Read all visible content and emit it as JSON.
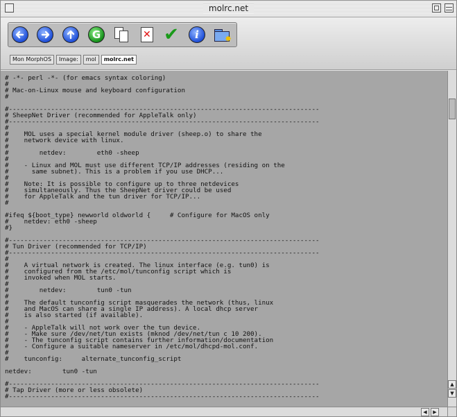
{
  "window": {
    "title": "molrc.net"
  },
  "toolbar": {
    "buttons": [
      {
        "name": "back-button",
        "icon": "arrow-left-icon"
      },
      {
        "name": "forward-button",
        "icon": "arrow-right-icon"
      },
      {
        "name": "up-button",
        "icon": "arrow-up-icon"
      },
      {
        "name": "go-button",
        "icon": "g-circle-icon",
        "glyph": "G"
      },
      {
        "name": "copy-button",
        "icon": "copy-documents-icon"
      },
      {
        "name": "delete-button",
        "icon": "delete-page-icon"
      },
      {
        "name": "confirm-button",
        "icon": "checkmark-icon"
      },
      {
        "name": "info-button",
        "icon": "info-icon",
        "glyph": "i"
      },
      {
        "name": "new-folder-button",
        "icon": "folder-star-icon"
      }
    ],
    "accent_blue": "#1f4fd8",
    "accent_green": "#15901a"
  },
  "breadcrumb": [
    "Mon MorphOS",
    "Image:",
    "mol",
    "molrc.net"
  ],
  "content": {
    "background": "#a6a6a6",
    "text": "# -*- perl -*- (for emacs syntax coloring)\n#\n# Mac-on-Linux mouse and keyboard configuration\n#\n\n#---------------------------------------------------------------------------------\n# SheepNet Driver (recommended for AppleTalk only)\n#---------------------------------------------------------------------------------\n#\n#    MOL uses a special kernel module driver (sheep.o) to share the\n#    network device with linux.\n#\n#        netdev:        eth0 -sheep\n#\n#    - Linux and MOL must use different TCP/IP addresses (residing on the\n#      same subnet). This is a problem if you use DHCP...\n#\n#    Note: It is possible to configure up to three netdevices\n#    simultaneously. Thus the SheepNet driver could be used\n#    for AppleTalk and the tun driver for TCP/IP...\n#\n\n#ifeq ${boot_type} newworld oldworld {     # Configure for MacOS only\n#    netdev: eth0 -sheep\n#}\n\n#---------------------------------------------------------------------------------\n# Tun Driver (recommended for TCP/IP)\n#---------------------------------------------------------------------------------\n#\n#    A virtual network is created. The linux interface (e.g. tun0) is\n#    configured from the /etc/mol/tunconfig script which is\n#    invoked when MOL starts.\n#\n#        netdev:        tun0 -tun\n#\n#    The default tunconfig script masquerades the network (thus, linux\n#    and MacOS can share a single IP address). A local dhcp server\n#    is also started (if available).\n#\n#    - AppleTalk will not work over the tun device.\n#    - Make sure /dev/net/tun exists (mknod /dev/net/tun c 10 200).\n#    - The tunconfig script contains further information/documentation\n#    - Configure a suitable nameserver in /etc/mol/dhcpd-mol.conf.\n#\n#    tunconfig:     alternate_tunconfig_script\n\nnetdev:        tun0 -tun\n\n#---------------------------------------------------------------------------------\n# Tap Driver (more or less obsolete)\n#---------------------------------------------------------------------------------"
  },
  "scrollbars": {
    "up_arrow": "▲",
    "down_arrow": "▼",
    "left_arrow": "◀",
    "right_arrow": "▶"
  }
}
